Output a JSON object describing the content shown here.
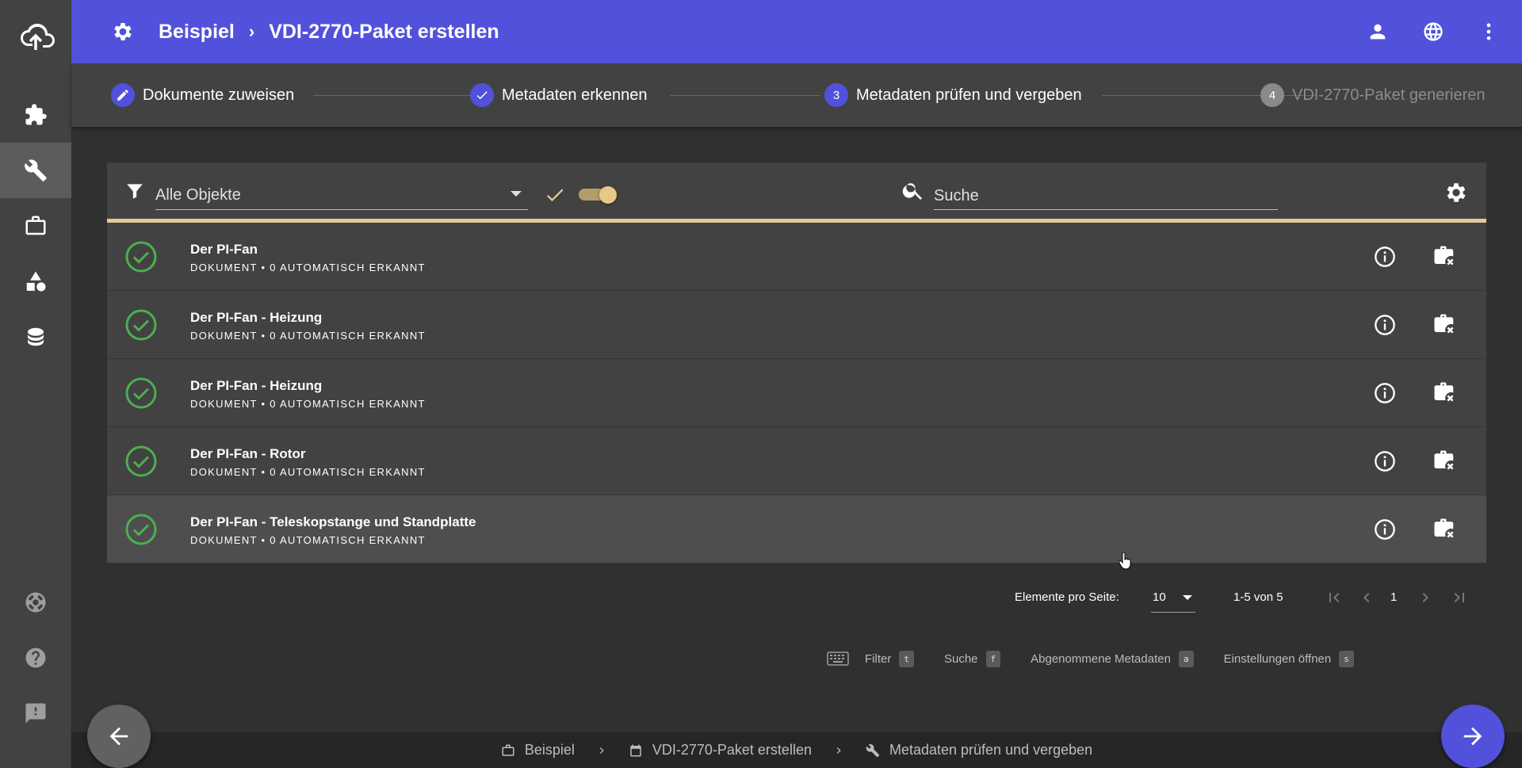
{
  "header": {
    "crumb_root": "Beispiel",
    "crumb_page": "VDI-2770-Paket erstellen"
  },
  "stepper": {
    "steps": [
      {
        "number": "1",
        "label": "Dokumente zuweisen",
        "state": "done"
      },
      {
        "number": "2",
        "label": "Metadaten erkennen",
        "state": "done"
      },
      {
        "number": "3",
        "label": "Metadaten prüfen und vergeben",
        "state": "active"
      },
      {
        "number": "4",
        "label": "VDI-2770-Paket generieren",
        "state": "pending"
      }
    ]
  },
  "toolbar": {
    "filter_value": "Alle Objekte",
    "search_placeholder": "Suche",
    "toggle_on": true
  },
  "rows": [
    {
      "title": "Der PI-Fan",
      "subtitle": "DOKUMENT • 0 AUTOMATISCH ERKANNT"
    },
    {
      "title": "Der PI-Fan - Heizung",
      "subtitle": "DOKUMENT • 0 AUTOMATISCH ERKANNT"
    },
    {
      "title": "Der PI-Fan - Heizung",
      "subtitle": "DOKUMENT • 0 AUTOMATISCH ERKANNT"
    },
    {
      "title": "Der PI-Fan - Rotor",
      "subtitle": "DOKUMENT • 0 AUTOMATISCH ERKANNT"
    },
    {
      "title": "Der PI-Fan - Teleskopstange und Standplatte",
      "subtitle": "DOKUMENT • 0 AUTOMATISCH ERKANNT"
    }
  ],
  "pager": {
    "items_label": "Elemente pro Seite:",
    "page_size": "10",
    "range": "1-5 von 5",
    "page": "1"
  },
  "shortcuts": [
    {
      "label": "Filter",
      "key": "t"
    },
    {
      "label": "Suche",
      "key": "f"
    },
    {
      "label": "Abgenommene Metadaten",
      "key": "a"
    },
    {
      "label": "Einstellungen öffnen",
      "key": "s"
    }
  ],
  "bottom_breadcrumb": {
    "item1": "Beispiel",
    "item2": "VDI-2770-Paket erstellen",
    "item3": "Metadaten prüfen und vergeben"
  },
  "colors": {
    "primary": "#5151db",
    "accent": "#e2c99a",
    "success": "#4caf50",
    "background": "#303030",
    "surface": "#424242"
  }
}
